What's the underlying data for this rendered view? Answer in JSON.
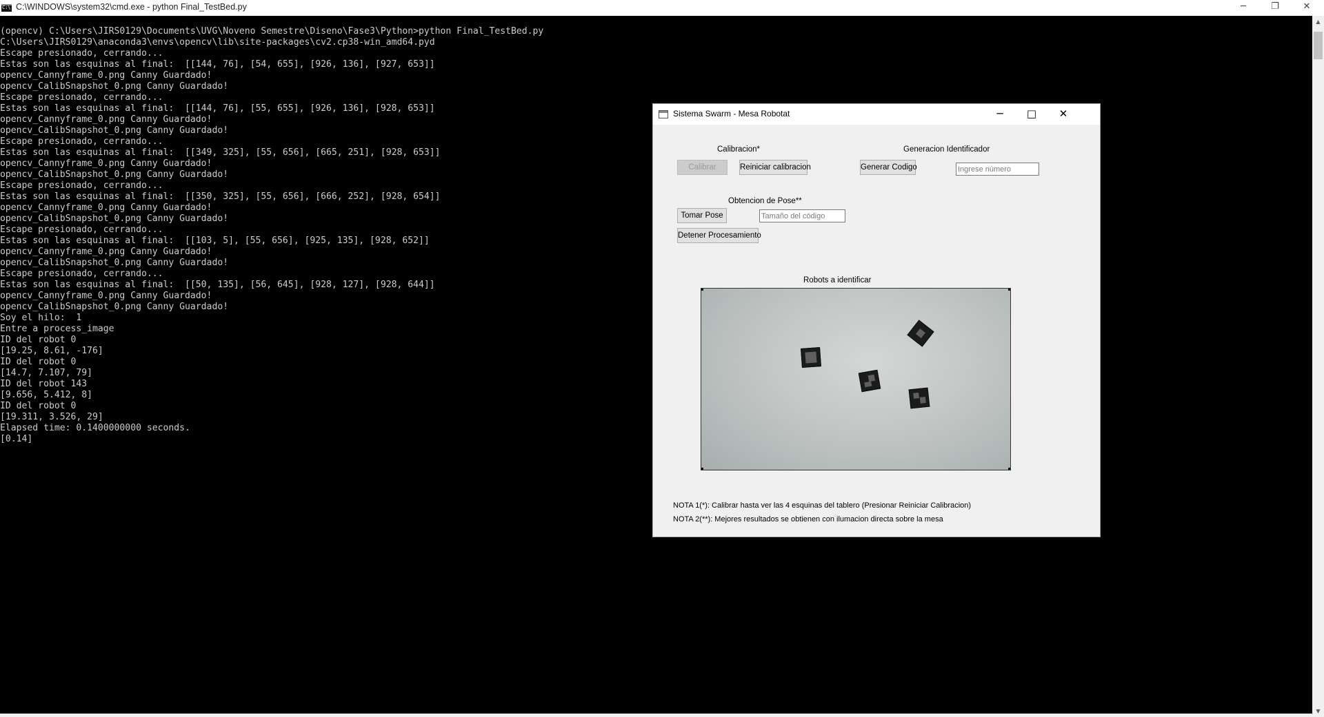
{
  "console": {
    "title": "C:\\WINDOWS\\system32\\cmd.exe - python  Final_TestBed.py",
    "lines": [
      "(opencv) C:\\Users\\JIRS0129\\Documents\\UVG\\Noveno Semestre\\Diseno\\Fase3\\Python>python Final_TestBed.py",
      "C:\\Users\\JIRS0129\\anaconda3\\envs\\opencv\\lib\\site-packages\\cv2.cp38-win_amd64.pyd",
      "Escape presionado, cerrando...",
      "Estas son las esquinas al final:  [[144, 76], [54, 655], [926, 136], [927, 653]]",
      "opencv_Cannyframe_0.png Canny Guardado!",
      "opencv_CalibSnapshot_0.png Canny Guardado!",
      "Escape presionado, cerrando...",
      "Estas son las esquinas al final:  [[144, 76], [55, 655], [926, 136], [928, 653]]",
      "opencv_Cannyframe_0.png Canny Guardado!",
      "opencv_CalibSnapshot_0.png Canny Guardado!",
      "Escape presionado, cerrando...",
      "Estas son las esquinas al final:  [[349, 325], [55, 656], [665, 251], [928, 653]]",
      "opencv_Cannyframe_0.png Canny Guardado!",
      "opencv_CalibSnapshot_0.png Canny Guardado!",
      "Escape presionado, cerrando...",
      "Estas son las esquinas al final:  [[350, 325], [55, 656], [666, 252], [928, 654]]",
      "opencv_Cannyframe_0.png Canny Guardado!",
      "opencv_CalibSnapshot_0.png Canny Guardado!",
      "Escape presionado, cerrando...",
      "Estas son las esquinas al final:  [[103, 5], [55, 656], [925, 135], [928, 652]]",
      "opencv_Cannyframe_0.png Canny Guardado!",
      "opencv_CalibSnapshot_0.png Canny Guardado!",
      "Escape presionado, cerrando...",
      "Estas son las esquinas al final:  [[50, 135], [56, 645], [928, 127], [928, 644]]",
      "opencv_Cannyframe_0.png Canny Guardado!",
      "opencv_CalibSnapshot_0.png Canny Guardado!",
      "Soy el hilo:  1",
      "Entre a process_image",
      "ID del robot 0",
      "[19.25, 8.61, -176]",
      "ID del robot 0",
      "[14.7, 7.107, 79]",
      "ID del robot 143",
      "[9.656, 5.412, 8]",
      "ID del robot 0",
      "[19.311, 3.526, 29]",
      "Elapsed time: 0.1400000000 seconds.",
      "[0.14]"
    ]
  },
  "window_controls": {
    "minimize": "─",
    "maximize": "□",
    "restore": "❐",
    "close": "✕"
  },
  "dialog": {
    "title": "Sistema Swarm - Mesa Robotat",
    "calibration": {
      "label": "Calibracion*",
      "calibrate_button": "Calibrar",
      "reset_button": "Reiniciar calibracion"
    },
    "id_generation": {
      "label": "Generacion Identificador",
      "generate_button": "Generar Codigo",
      "number_placeholder": "Ingrese número"
    },
    "pose": {
      "label": "Obtencion de Pose**",
      "take_pose_button": "Tomar Pose",
      "code_size_placeholder": "Tamaño del código",
      "stop_button": "Detener Procesamiento"
    },
    "robots_label": "Robots a identificar",
    "note1": "NOTA 1(*): Calibrar hasta ver las 4 esquinas del tablero (Presionar Reiniciar Calibracion)",
    "note2": "NOTA 2(**): Mejores resultados se obtienen con ilumacion directa sobre la mesa"
  }
}
